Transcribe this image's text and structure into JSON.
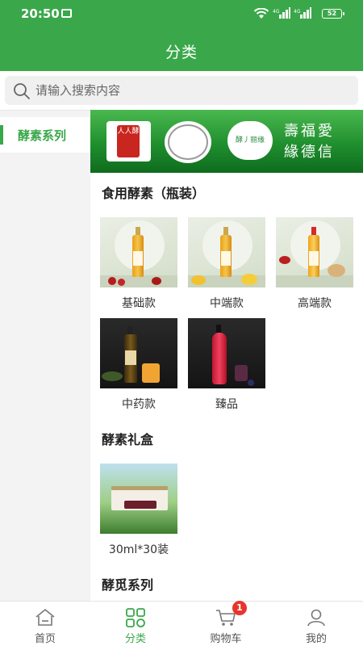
{
  "status_bar": {
    "time": "20:50",
    "battery": "52"
  },
  "header": {
    "title": "分类"
  },
  "search": {
    "placeholder": "请输入搜索内容"
  },
  "sidebar": {
    "items": [
      {
        "label": "酵素系列",
        "active": true
      }
    ]
  },
  "banner": {
    "logo1_text": "人人酵",
    "logo3_text": "酵丿丽缘",
    "slogan_line1": "壽福愛",
    "slogan_line2": "緣德信"
  },
  "sections": [
    {
      "title": "食用酵素（瓶装）",
      "products": [
        {
          "name": "基础款"
        },
        {
          "name": "中端款"
        },
        {
          "name": "高端款"
        },
        {
          "name": "中药款"
        },
        {
          "name": "臻品"
        }
      ]
    },
    {
      "title": "酵素礼盒",
      "products": [
        {
          "name": "30ml*30装"
        }
      ]
    },
    {
      "title": "酵觅系列",
      "products": []
    }
  ],
  "bottom_nav": {
    "items": [
      {
        "label": "首页",
        "icon": "home-icon"
      },
      {
        "label": "分类",
        "icon": "category-icon",
        "active": true
      },
      {
        "label": "购物车",
        "icon": "cart-icon",
        "badge": "1"
      },
      {
        "label": "我的",
        "icon": "profile-icon"
      }
    ]
  },
  "colors": {
    "brand_green": "#3aa84a",
    "badge_red": "#e8352c"
  }
}
